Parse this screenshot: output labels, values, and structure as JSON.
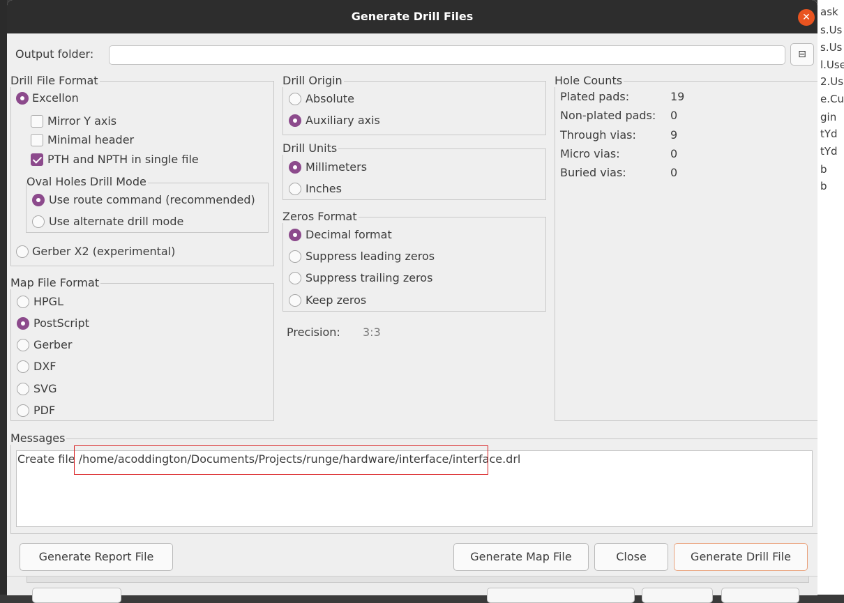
{
  "background": {
    "right_fragments": [
      "ask",
      "s.Us",
      "s.Us",
      "l.Use",
      "2.Us",
      "e.Cu",
      "gin",
      "tYd",
      "tYd",
      "b",
      "b"
    ]
  },
  "dialog": {
    "title": "Generate Drill Files",
    "close_icon": "close-icon",
    "accent_color": "#8c4a8c",
    "titlebar_color": "#2d2d2d",
    "close_color": "#e95420"
  },
  "output": {
    "label": "Output folder:",
    "value": "",
    "folder_icon": "folder-browse-icon"
  },
  "drill_file_format": {
    "title": "Drill File Format",
    "excellon": "Excellon",
    "mirror_y": "Mirror Y axis",
    "minimal_header": "Minimal header",
    "pth_npth": "PTH and NPTH in single file",
    "oval_title": "Oval Holes Drill Mode",
    "use_route": "Use route command (recommended)",
    "use_alternate": "Use alternate drill mode",
    "gerber_x2": "Gerber X2 (experimental)"
  },
  "map_file_format": {
    "title": "Map File Format",
    "options": [
      "HPGL",
      "PostScript",
      "Gerber",
      "DXF",
      "SVG",
      "PDF"
    ],
    "selected": "PostScript"
  },
  "drill_origin": {
    "title": "Drill Origin",
    "absolute": "Absolute",
    "auxiliary": "Auxiliary axis"
  },
  "drill_units": {
    "title": "Drill Units",
    "millimeters": "Millimeters",
    "inches": "Inches"
  },
  "zeros_format": {
    "title": "Zeros Format",
    "decimal": "Decimal format",
    "suppress_leading": "Suppress leading zeros",
    "suppress_trailing": "Suppress trailing zeros",
    "keep": "Keep zeros"
  },
  "precision": {
    "label": "Precision:",
    "value": "3:3"
  },
  "hole_counts": {
    "title": "Hole Counts",
    "rows": [
      {
        "label": "Plated pads:",
        "value": "19"
      },
      {
        "label": "Non-plated pads:",
        "value": "0"
      },
      {
        "label": "Through vias:",
        "value": "9"
      },
      {
        "label": "Micro vias:",
        "value": "0"
      },
      {
        "label": "Buried vias:",
        "value": "0"
      }
    ]
  },
  "messages": {
    "title": "Messages",
    "text": "Create file /home/acoddington/Documents/Projects/runge/hardware/interface/interface.drl"
  },
  "buttons": {
    "report": "Generate Report File",
    "map": "Generate Map File",
    "close": "Close",
    "drill": "Generate Drill File"
  }
}
